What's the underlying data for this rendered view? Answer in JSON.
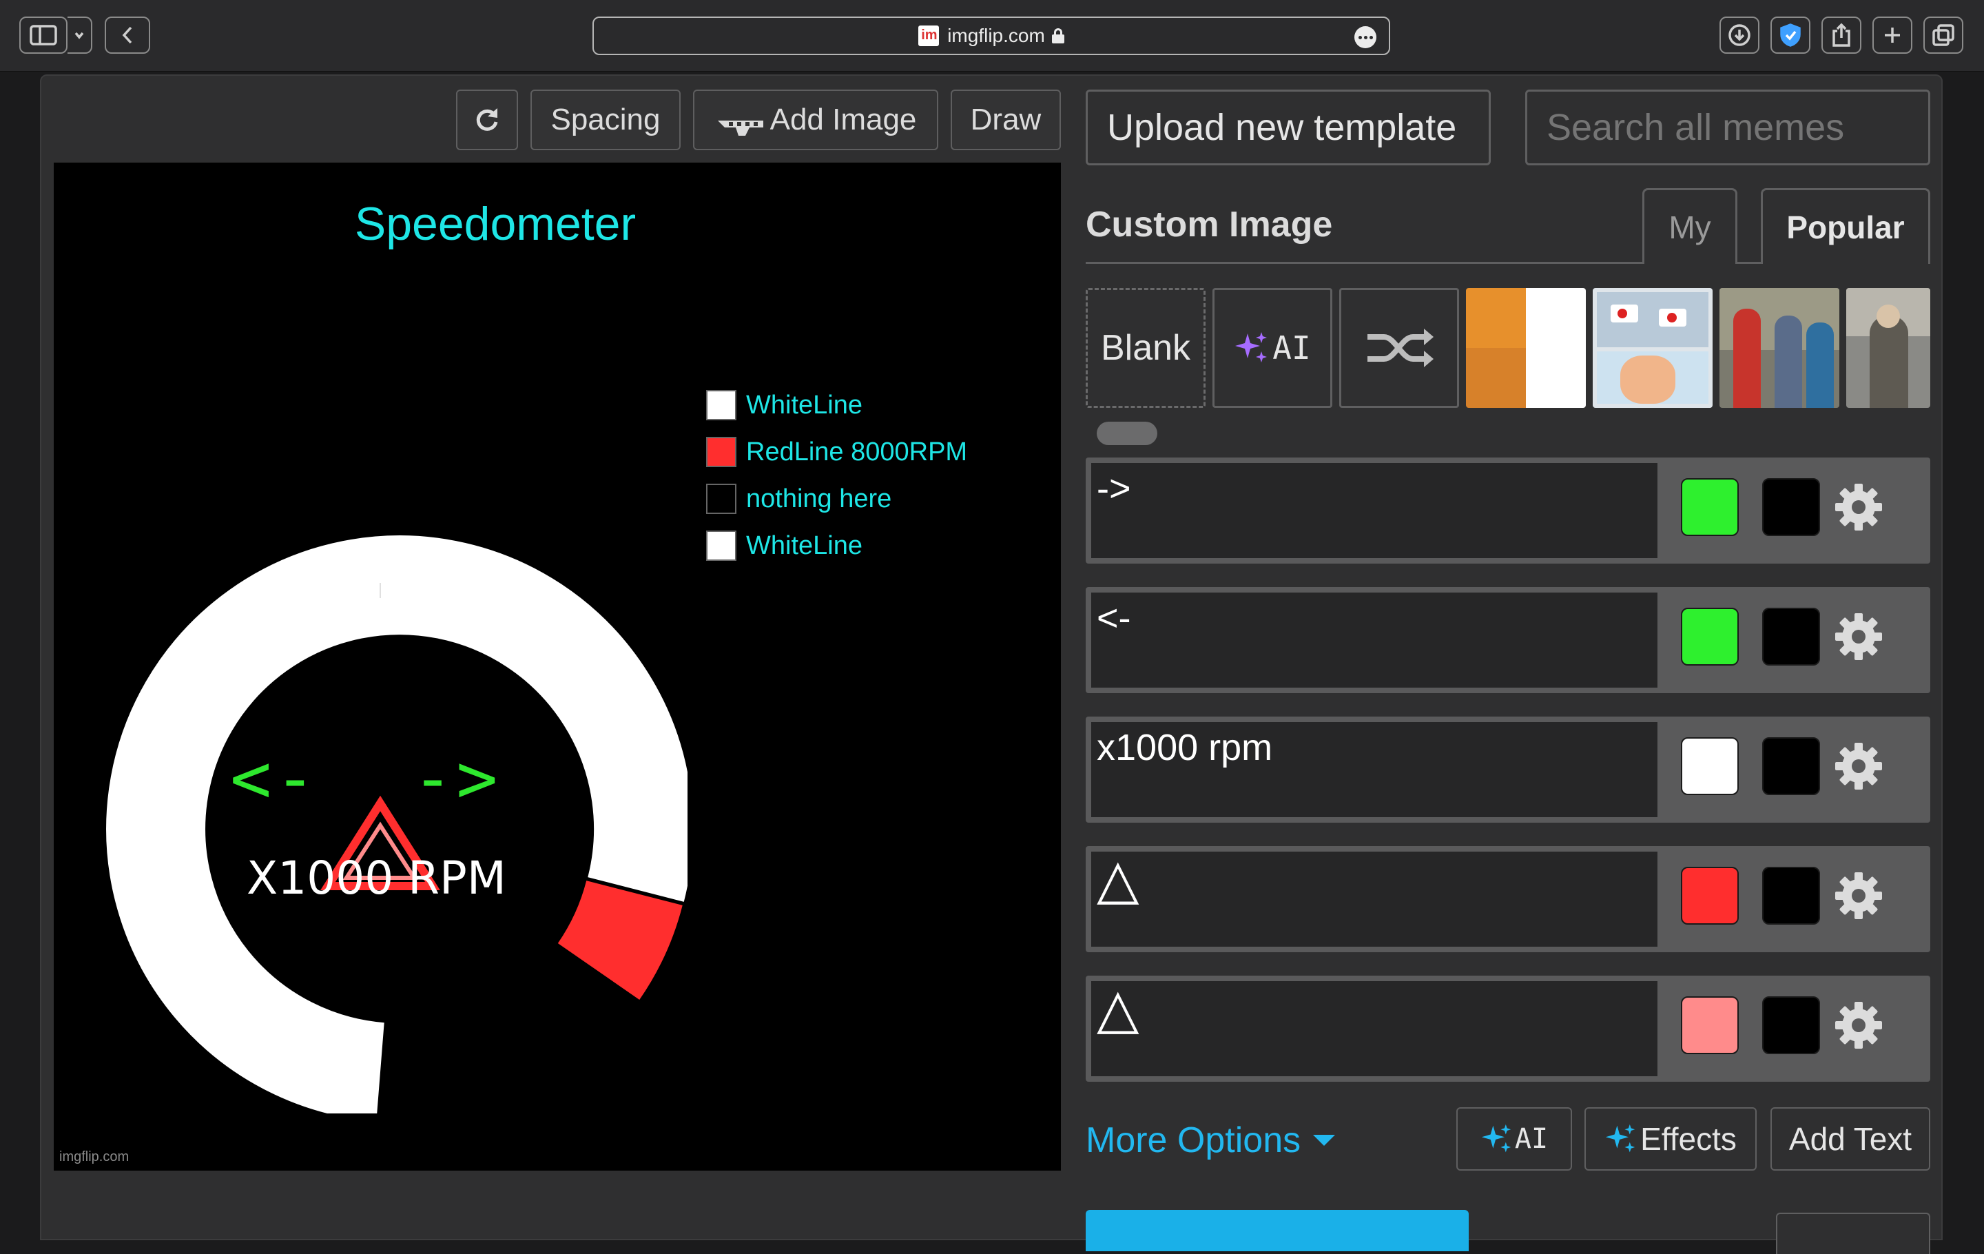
{
  "browser": {
    "url": "imgflip.com",
    "icons": [
      "sidebar-icon",
      "chevron-down-icon",
      "back-icon",
      "download-icon",
      "shield-icon",
      "share-icon",
      "plus-icon",
      "tabs-icon"
    ]
  },
  "toolbar": {
    "spacing_label": "Spacing",
    "add_image_label": "Add Image",
    "draw_label": "Draw",
    "upload_label": "Upload new template",
    "search_placeholder": "Search all memes"
  },
  "canvas": {
    "title": "Speedometer",
    "legend": [
      {
        "label": "WhiteLine",
        "color": "#ffffff"
      },
      {
        "label": "RedLine 8000RPM",
        "color": "#ff2e2e"
      },
      {
        "label": "nothing here",
        "color": "#000000"
      },
      {
        "label": "WhiteLine",
        "color": "#ffffff"
      }
    ],
    "left_arrow": "<-",
    "right_arrow": "->",
    "rpm_label": "X1000 RPM",
    "watermark": "imgflip.com",
    "colors": {
      "title": "#1ee6e6",
      "arrows": "#2ee82e",
      "redline": "#ff2e2e"
    }
  },
  "panel": {
    "title": "Custom Image",
    "tab_my": "My",
    "tab_popular": "Popular",
    "blank_label": "Blank",
    "ai_label": "AI",
    "more_options": "More Options",
    "effects_label": "Effects",
    "add_text_label": "Add Text",
    "ai_btn_label": "AI"
  },
  "text_rows": [
    {
      "text": "->",
      "color": "#2ef02e",
      "outline": "#000000"
    },
    {
      "text": "<-",
      "color": "#2ef02e",
      "outline": "#000000"
    },
    {
      "text": "x1000 rpm",
      "color": "#ffffff",
      "outline": "#000000"
    },
    {
      "text": "△",
      "color": "#ff2e2e",
      "outline": "#000000"
    },
    {
      "text": "△",
      "color": "#ff8b8b",
      "outline": "#000000"
    }
  ]
}
